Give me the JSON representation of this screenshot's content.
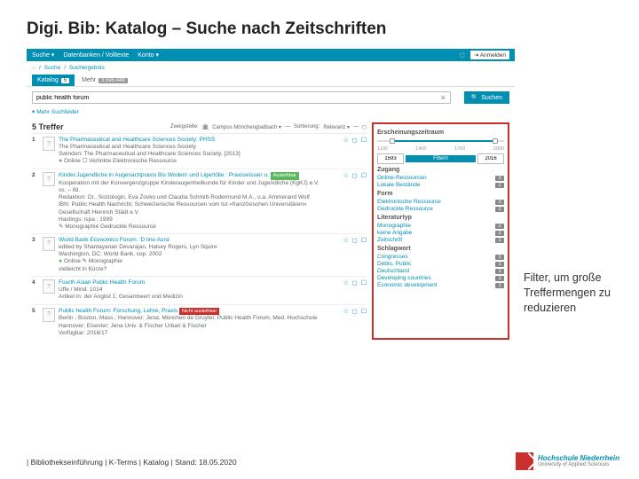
{
  "slide": {
    "title": "Digi. Bib: Katalog – Suche nach Zeitschriften"
  },
  "topnav": {
    "search": "Suche ▾",
    "db": "Datenbanken / Volltexte",
    "account": "Konto ▾",
    "login": "⇥ Anmelden"
  },
  "breadcrumb": {
    "l1": "Suche",
    "l2": "Suchergebnis"
  },
  "tabs": {
    "active": "Katalog",
    "activeCount": "5",
    "inactive": "Mehr",
    "inactiveCount": "3.595.449"
  },
  "search": {
    "value": "public health forum",
    "btn": "Suchen",
    "adv": "Mehr Suchfelder"
  },
  "resultsHeader": {
    "count": "5 Treffer",
    "branchLabel": "Zweigstelle:",
    "branch": "Campus Mönchengladbach ▾",
    "sortLabel": "Sortierung:",
    "sort": "Relevanz ▾"
  },
  "results": [
    {
      "num": "1",
      "title": "The Pharmaceutical and Healthcare Sciences Society: PHSS",
      "lines": [
        "The Pharmaceutical and Healthcare Sciences Society",
        "Swindon: The Pharmaceutical and Healthcare Sciences Society, [2013]",
        "● Online ☐ Verlinkte Elektronische Ressource"
      ]
    },
    {
      "num": "2",
      "title": "Kinder.Jugendliche in Augenarztpraxis Bis Wodern und Ligertölle : Praxiswissen u.",
      "avail": "Ausleihbar",
      "lines": [
        "Kooperation mit der Konvergenzgruppe Kinderaugenheilkunde für Kinder und Jugendliche (KgKJ) e.V.",
        "vs. – ifd.",
        "Redaktion: Dr., Soziologin, Eva Zovko und Claudia Schmitt-Rodermund M.A., u.a. Ammerand Wolf",
        "IBN: Public Health Nachricht, Schweizerische Ressourcen vom tut «französischen Universitären»",
        "Gesellschaft Heinrich Städt e.V.",
        "Hastings: ispa ; 1999",
        "✎ Monographie   Gedruckte Ressource"
      ]
    },
    {
      "num": "3",
      "title": "World Bank Economics Forum. 'D line Aura'",
      "lines": [
        "edited by Shantayanan Devarajan, Halsey Rogers, Lyn Squire",
        "Washington, DC: World Bank, cop. 2002",
        "● Online  ✎ Monographie",
        "vielleicht in Kürze?"
      ]
    },
    {
      "num": "4",
      "title": "Fourth Asian Public Health Forum",
      "lines": [
        "Uffe / Mind: 1014",
        "Artikel in: der Anglist 1; Gesamtwert und Medizin"
      ]
    },
    {
      "num": "5",
      "title": "Public health Forum: Forschung, Lehre, Praxis",
      "notavail": "Nicht ausleihbar",
      "lines": [
        "Berlin ; Boston, Mass.; Hannover; Jena; München de Gruyter, Public Health Forum, Med. Hochschule Hannover; Elsevier; Jena Univ. & Fischer Urban & Fischer",
        "Verfügbar: 2016/17"
      ]
    }
  ],
  "sidebar": {
    "sect1": "Erscheinungszeitraum",
    "ticks": [
      "1100",
      "1400",
      "1700",
      "2000"
    ],
    "yearFrom": "1593",
    "filterBtn": "Filtern",
    "yearTo": "2016",
    "sect2": "Zugang",
    "access": [
      {
        "l": "Online-Ressourcen",
        "c": "3"
      },
      {
        "l": "Lokale Bestände",
        "c": "2"
      }
    ],
    "sect3": "Form",
    "form": [
      {
        "l": "Elektronische Ressource",
        "c": "3"
      },
      {
        "l": "Gedruckte Ressource",
        "c": "2"
      }
    ],
    "sect4": "Literaturtyp",
    "littype": [
      {
        "l": "Monographie",
        "c": "2"
      },
      {
        "l": "keine Angabe",
        "c": "2"
      },
      {
        "l": "Zeitschrift",
        "c": "1"
      }
    ],
    "sect5": "Schlagwort",
    "keywords": [
      {
        "l": "Congresses",
        "c": "1"
      },
      {
        "l": "Debts, Public",
        "c": "1"
      },
      {
        "l": "Deutschland",
        "c": "1"
      },
      {
        "l": "Developing countries",
        "c": "1"
      },
      {
        "l": "Economic development",
        "c": "1"
      }
    ]
  },
  "callout": "Filter, um große Treffer­mengen zu reduzieren",
  "footer": "| Bibliothekseinführung | K-Terms | Katalog | Stand: 18.05.2020",
  "logo": {
    "name": "Hochschule Niederrhein",
    "sub": "University of Applied Sciences"
  }
}
